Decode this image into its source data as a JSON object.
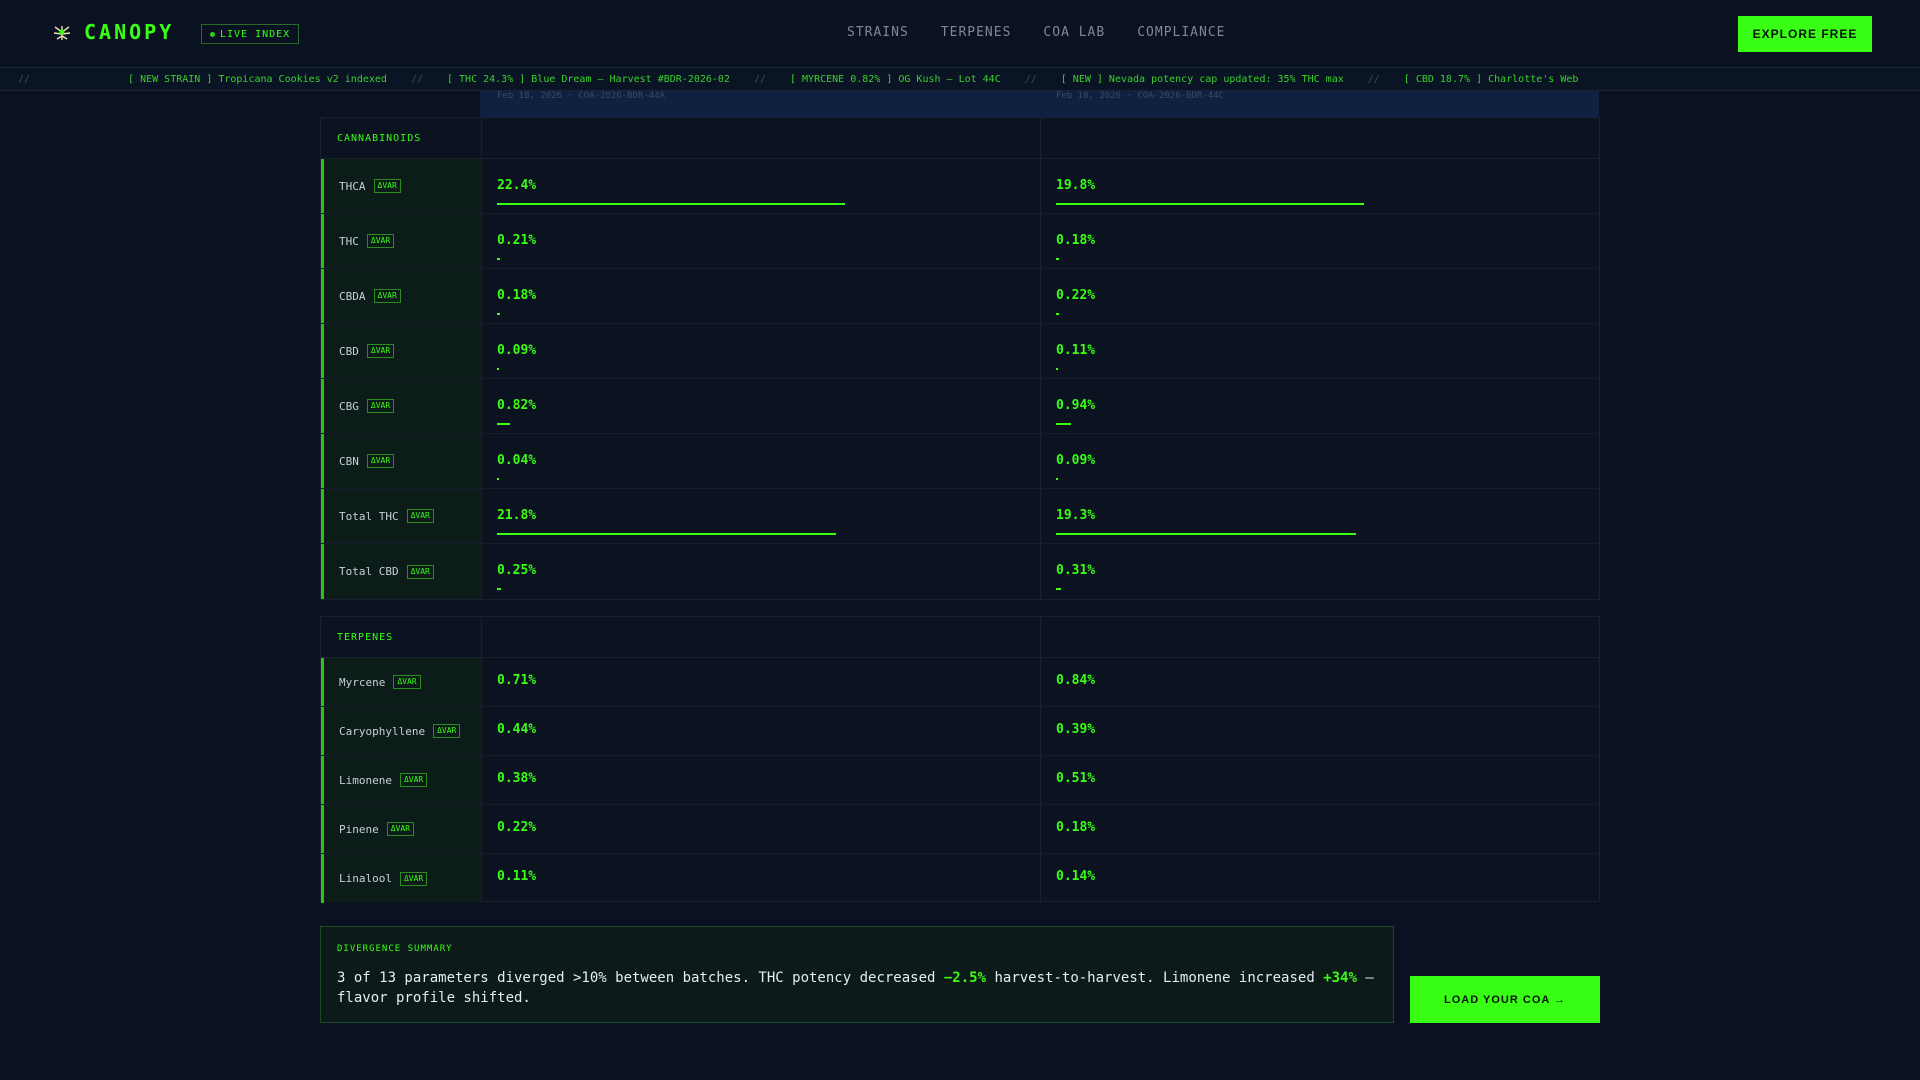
{
  "brand": {
    "name": "CANOPY",
    "live_badge": "LIVE INDEX"
  },
  "nav": [
    "STRAINS",
    "TERPENES",
    "COA LAB",
    "COMPLIANCE"
  ],
  "header_cta": "EXPLORE FREE",
  "ticker": [
    "[ NEW STRAIN ] Tropicana Cookies v2 indexed",
    "[ THC 24.3% ] Blue Dream — Harvest #BDR-2026-02",
    "[ MYRCENE 0.82% ] OG Kush — Lot 44C",
    "[ NEW ] Nevada potency cap updated: 35% THC max",
    "[ CBD 18.7% ] Charlotte's Web"
  ],
  "ticker_sep": "//",
  "ghost_header": {
    "col1": "Feb 18, 2026 · COA-2026-BDR-44A",
    "col2": "Feb 18, 2026 · COA-2026-BDR-44C"
  },
  "cannabinoids": {
    "title": "CANNABINOIDS",
    "var_label": "ΔVAR",
    "rows": [
      {
        "name": "THCA",
        "a": "22.4%",
        "b": "19.8%",
        "a_num": 22.4,
        "b_num": 19.8
      },
      {
        "name": "THC",
        "a": "0.21%",
        "b": "0.18%",
        "a_num": 0.21,
        "b_num": 0.18
      },
      {
        "name": "CBDA",
        "a": "0.18%",
        "b": "0.22%",
        "a_num": 0.18,
        "b_num": 0.22
      },
      {
        "name": "CBD",
        "a": "0.09%",
        "b": "0.11%",
        "a_num": 0.09,
        "b_num": 0.11
      },
      {
        "name": "CBG",
        "a": "0.82%",
        "b": "0.94%",
        "a_num": 0.82,
        "b_num": 0.94
      },
      {
        "name": "CBN",
        "a": "0.04%",
        "b": "0.09%",
        "a_num": 0.04,
        "b_num": 0.09
      },
      {
        "name": "Total THC",
        "a": "21.8%",
        "b": "19.3%",
        "a_num": 21.8,
        "b_num": 19.3
      },
      {
        "name": "Total CBD",
        "a": "0.25%",
        "b": "0.31%",
        "a_num": 0.25,
        "b_num": 0.31
      }
    ]
  },
  "terpenes": {
    "title": "TERPENES",
    "var_label": "ΔVAR",
    "rows": [
      {
        "name": "Myrcene",
        "a": "0.71%",
        "b": "0.84%"
      },
      {
        "name": "Caryophyllene",
        "a": "0.44%",
        "b": "0.39%"
      },
      {
        "name": "Limonene",
        "a": "0.38%",
        "b": "0.51%"
      },
      {
        "name": "Pinene",
        "a": "0.22%",
        "b": "0.18%"
      },
      {
        "name": "Linalool",
        "a": "0.11%",
        "b": "0.14%"
      }
    ]
  },
  "summary": {
    "title": "DIVERGENCE SUMMARY",
    "text_1": "3 of 13 parameters diverged >10% between batches. THC potency decreased ",
    "hl_1": "−2.5%",
    "text_2": " harvest-to-harvest. Limonene increased ",
    "hl_2": "+34%",
    "text_3": " — flavor profile shifted."
  },
  "load_cta": "LOAD YOUR COA →",
  "colors": {
    "accent": "#39ff14",
    "bg": "#0a1120"
  }
}
